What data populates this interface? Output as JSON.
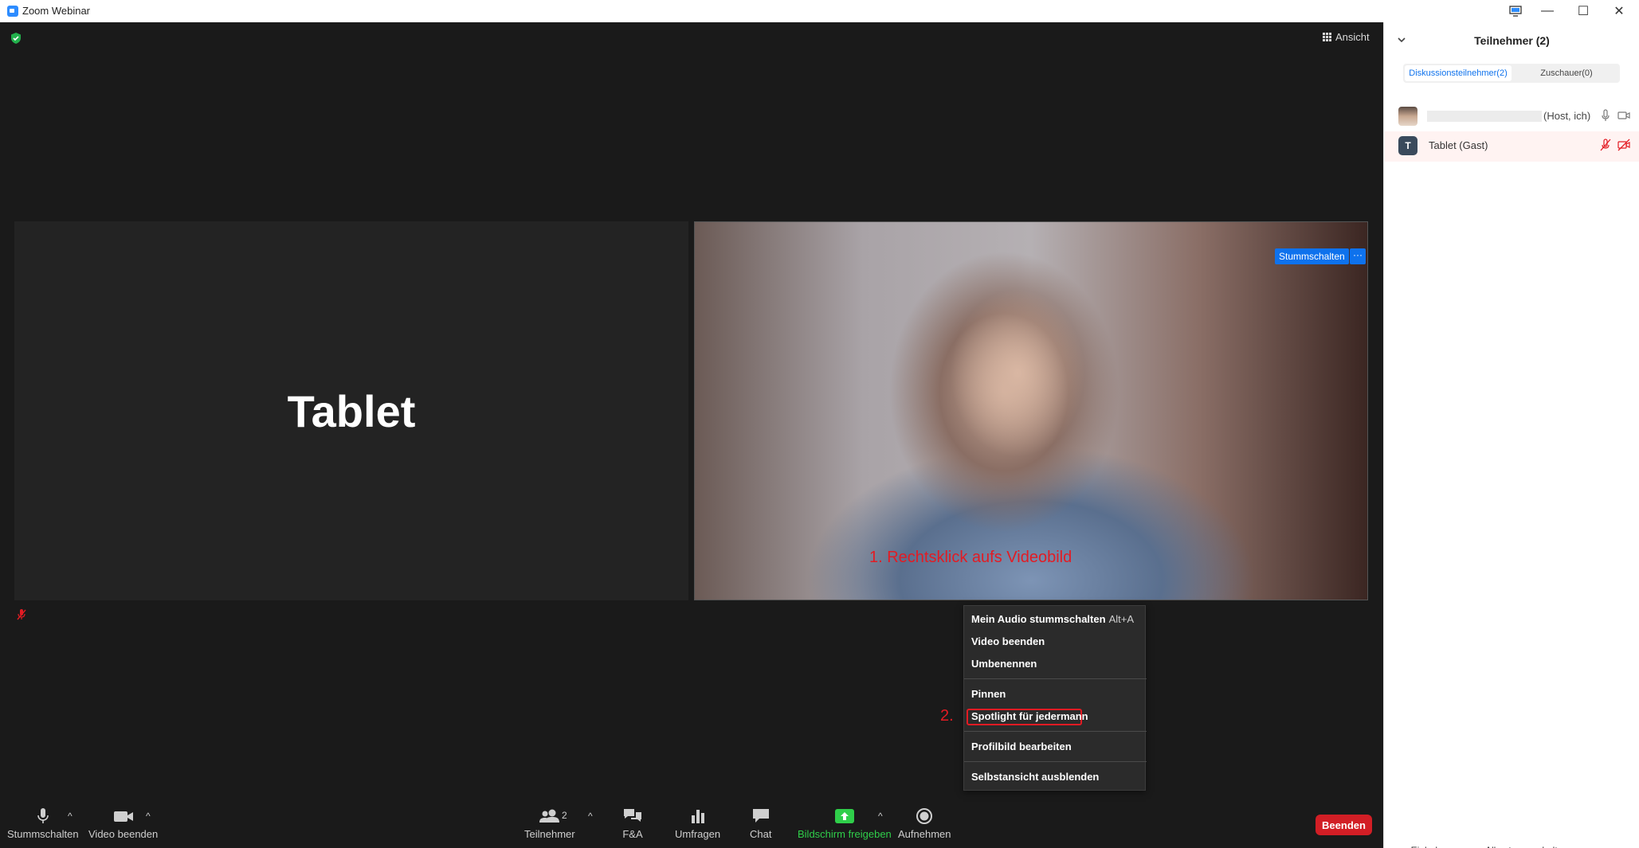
{
  "window": {
    "title": "Zoom Webinar",
    "controls": {
      "minimize": "—",
      "maximize": "☐",
      "close": "✕"
    }
  },
  "meeting": {
    "view_button": "Ansicht",
    "left_tile_name": "Tablet",
    "right_tile_badges": {
      "mute": "Stummschalten",
      "more": "···"
    },
    "annotations": {
      "step1": "1. Rechtsklick aufs Videobild",
      "step2": "2."
    }
  },
  "context_menu": {
    "items": [
      {
        "label": "Mein Audio stummschalten",
        "shortcut": "Alt+A"
      },
      {
        "label": "Video beenden"
      },
      {
        "label": "Umbenennen"
      },
      {
        "label": "Pinnen"
      },
      {
        "label": "Spotlight für jedermann"
      },
      {
        "label": "Profilbild bearbeiten"
      },
      {
        "label": "Selbstansicht ausblenden"
      }
    ],
    "highlight_color": "#e31b23"
  },
  "toolbar": {
    "mute": "Stummschalten",
    "video": "Video beenden",
    "participants": "Teilnehmer",
    "participants_count": "2",
    "qa": "F&A",
    "polls": "Umfragen",
    "chat": "Chat",
    "share": "Bildschirm freigeben",
    "record": "Aufnehmen",
    "end": "Beenden",
    "caret": "^"
  },
  "panel": {
    "title": "Teilnehmer (2)",
    "tabs": [
      {
        "label": "Diskussionsteilnehmer(2)",
        "active": true
      },
      {
        "label": "Zuschauer(0)",
        "active": false
      }
    ],
    "participants": [
      {
        "role_label": "(Host, ich)"
      },
      {
        "initial": "T",
        "label": "Tablet (Gast)"
      }
    ],
    "buttons": {
      "invite": "Einladen",
      "mute_all": "Alle stummschalten",
      "more": "..."
    }
  },
  "colors": {
    "accent": "#0e72ed",
    "share_green": "#2fce4a",
    "end_red": "#d21e25",
    "meeting_bg": "#1a1a1a"
  }
}
